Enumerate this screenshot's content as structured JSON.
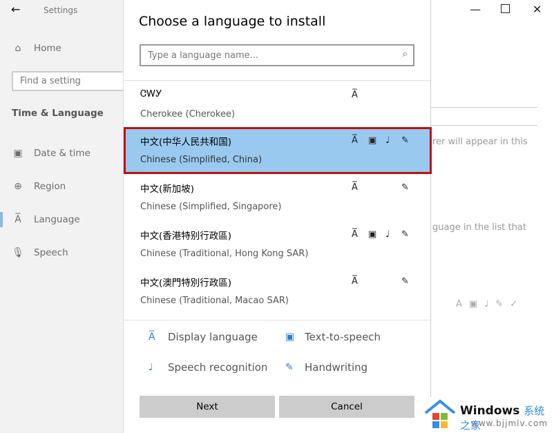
{
  "settings": {
    "title": "Settings",
    "back_icon": "arrow-left-icon",
    "home": "Home",
    "search_placeholder": "Find a setting",
    "section": "Time & Language",
    "nav": [
      {
        "label": "Date & time",
        "icon": "calendar-clock-icon"
      },
      {
        "label": "Region",
        "icon": "globe-icon"
      },
      {
        "label": "Language",
        "icon": "language-icon"
      },
      {
        "label": "Speech",
        "icon": "microphone-icon"
      }
    ],
    "bg_text_1": "rer will appear in this",
    "bg_text_2": "guage in the list that"
  },
  "dialog": {
    "title": "Choose a language to install",
    "search_placeholder": "Type a language name...",
    "languages": [
      {
        "native": "ᏣᎳᎩ",
        "name": "Cherokee (Cherokee)"
      },
      {
        "native": "中文(中华人民共和国)",
        "name": "Chinese (Simplified, China)",
        "selected": true
      },
      {
        "native": "中文(新加坡)",
        "name": "Chinese (Simplified, Singapore)"
      },
      {
        "native": "中文(香港特别行政區)",
        "name": "Chinese (Traditional, Hong Kong SAR)"
      },
      {
        "native": "中文(澳門特別行政區)",
        "name": "Chinese (Traditional, Macao SAR)"
      }
    ],
    "legend": {
      "display": "Display language",
      "tts": "Text-to-speech",
      "speech": "Speech recognition",
      "handwriting": "Handwriting"
    },
    "next": "Next",
    "cancel": "Cancel"
  },
  "colors": {
    "selected": "#99c9ef",
    "highlight_border": "#c0100f",
    "accent": "#2a7fd1"
  },
  "watermark": {
    "brand": "Windows",
    "cn": "系统之家",
    "url": "www.bjjmlv.com"
  }
}
